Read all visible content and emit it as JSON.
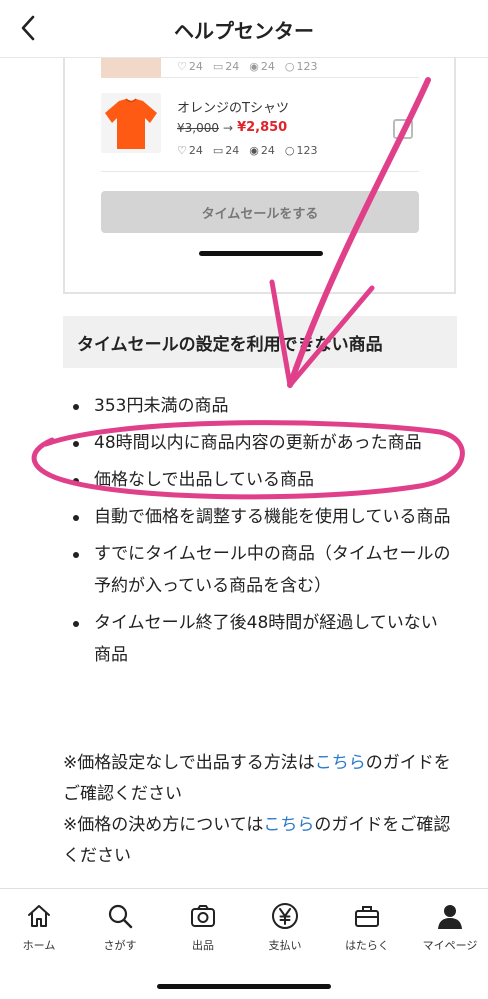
{
  "header": {
    "title": "ヘルプセンター"
  },
  "card": {
    "top_item": {
      "stats": {
        "likes": "24",
        "comments": "24",
        "views": "24",
        "searches": "123"
      }
    },
    "main_item": {
      "name": "オレンジのTシャツ",
      "old_price": "¥3,000",
      "new_price": "¥2,850",
      "stats": {
        "likes": "24",
        "comments": "24",
        "views": "24",
        "searches": "123"
      }
    },
    "button_label": "タイムセールをする"
  },
  "section": {
    "heading": "タイムセールの設定を利用できない商品"
  },
  "bullets": [
    "353円未満の商品",
    "48時間以内に商品内容の更新があった商品",
    "価格なしで出品している商品",
    "自動で価格を調整する機能を使用している商品",
    "すでにタイムセール中の商品（タイムセールの予約が入っている商品を含む）",
    "タイムセール終了後48時間が経過していない商品"
  ],
  "notes": {
    "note1_before": "※価格設定なしで出品する方法は",
    "note1_link": "こちら",
    "note1_after": "のガイドをご確認ください",
    "note2_before": "※価格の決め方については",
    "note2_link": "こちら",
    "note2_after": "のガイドをご確認ください"
  },
  "bottom_nav": {
    "items": [
      {
        "label": "ホーム",
        "icon": "home-icon"
      },
      {
        "label": "さがす",
        "icon": "search-icon"
      },
      {
        "label": "出品",
        "icon": "camera-icon"
      },
      {
        "label": "支払い",
        "icon": "yen-icon"
      },
      {
        "label": "はたらく",
        "icon": "briefcase-icon"
      },
      {
        "label": "マイページ",
        "icon": "person-icon"
      }
    ]
  },
  "colors": {
    "price_red": "#e0242c",
    "link_blue": "#2a7ac8",
    "annotation_pink": "#e0408a",
    "button_gray": "#d4d4d4"
  }
}
